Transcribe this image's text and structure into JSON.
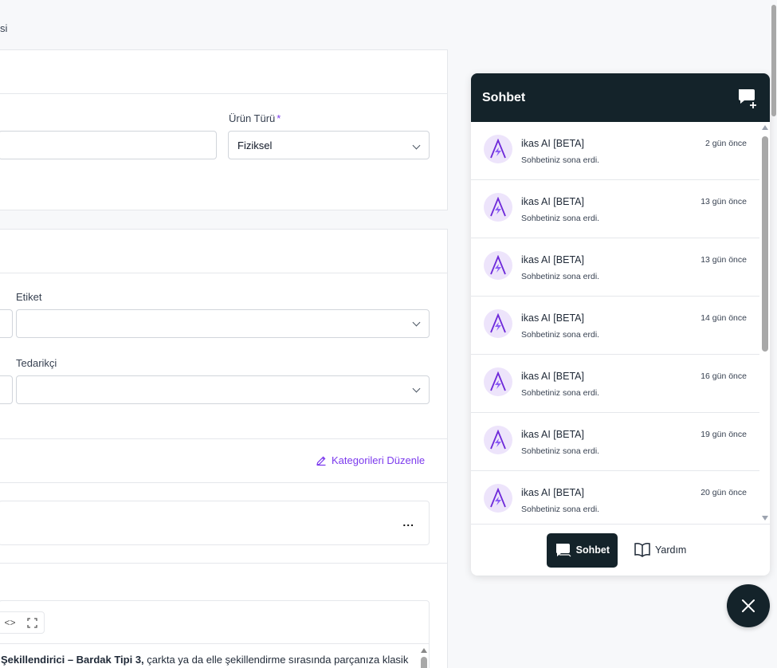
{
  "breadcrumb": "si",
  "product_type": {
    "label": "Ürün Türü",
    "required_mark": "*",
    "value": "Fiziksel"
  },
  "tag": {
    "label": "Etiket",
    "value": ""
  },
  "supplier": {
    "label": "Tedarikçi",
    "value": ""
  },
  "categories": {
    "edit_label": "Kategorileri Düzenle"
  },
  "more_menu": "...",
  "editor": {
    "code_icon": "<>",
    "text_bold": "Şekillendirici – Bardak Tipi 3,",
    "text_rest": " çarkta ya da elle şekillendirme sırasında parçanıza klasik"
  },
  "chat": {
    "title": "Sohbet",
    "items": [
      {
        "name": "ikas AI [BETA]",
        "message": "Sohbetiniz sona erdi.",
        "time": "2 gün önce"
      },
      {
        "name": "ikas AI [BETA]",
        "message": "Sohbetiniz sona erdi.",
        "time": "13 gün önce"
      },
      {
        "name": "ikas AI [BETA]",
        "message": "Sohbetiniz sona erdi.",
        "time": "13 gün önce"
      },
      {
        "name": "ikas AI [BETA]",
        "message": "Sohbetiniz sona erdi.",
        "time": "14 gün önce"
      },
      {
        "name": "ikas AI [BETA]",
        "message": "Sohbetiniz sona erdi.",
        "time": "16 gün önce"
      },
      {
        "name": "ikas AI [BETA]",
        "message": "Sohbetiniz sona erdi.",
        "time": "19 gün önce"
      },
      {
        "name": "ikas AI [BETA]",
        "message": "Sohbetiniz sona erdi.",
        "time": "20 gün önce"
      }
    ],
    "tabs": {
      "chat": "Sohbet",
      "help": "Yardım"
    }
  },
  "colors": {
    "accent": "#7c3aed",
    "dark": "#14232a",
    "avatar_bg": "#ede4fb"
  },
  "icons": [
    "new-chat-icon",
    "chevron-down-icon",
    "pencil-icon",
    "code-icon",
    "fullscreen-icon",
    "ikas-ai-logo-icon",
    "chat-bubble-icon",
    "book-icon",
    "close-icon"
  ]
}
